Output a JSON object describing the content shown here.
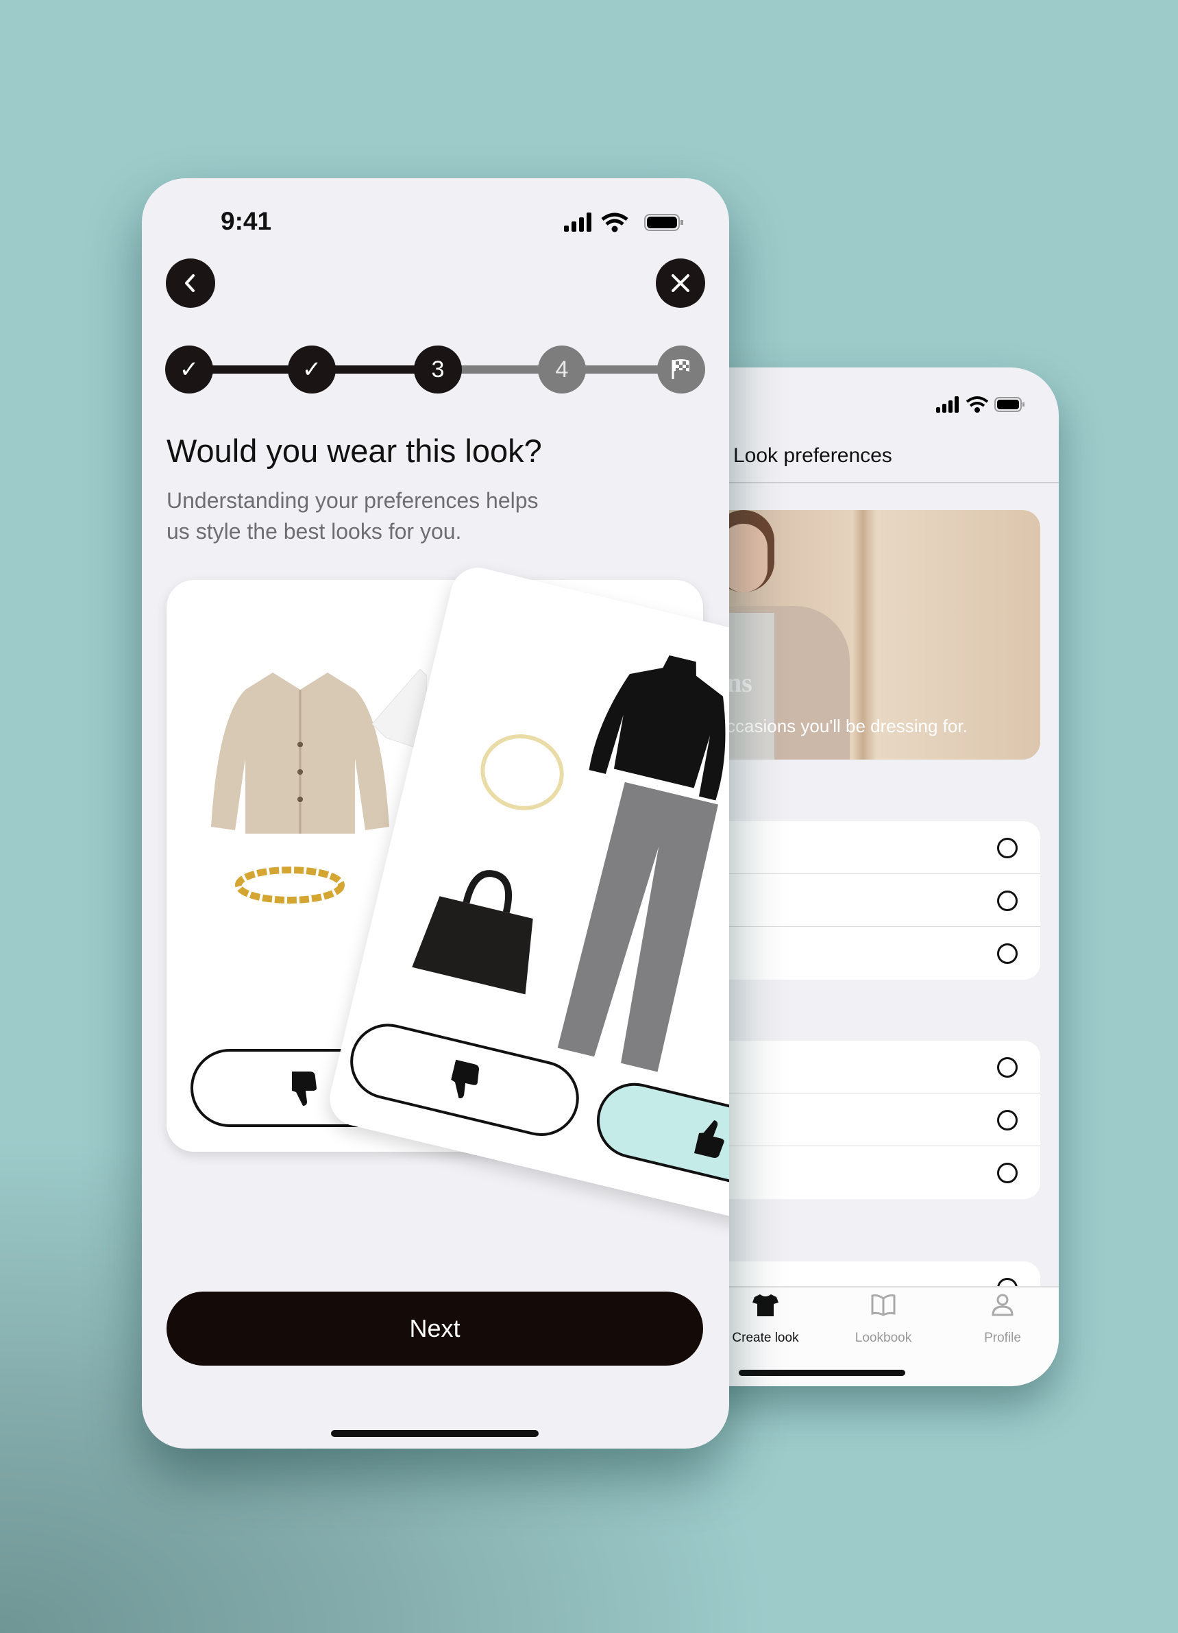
{
  "front_screen": {
    "status_time": "9:41",
    "back_icon": "chevron-left-icon",
    "close_icon": "close-icon",
    "steps": [
      {
        "label": "✓",
        "state": "done"
      },
      {
        "label": "✓",
        "state": "done"
      },
      {
        "label": "3",
        "state": "current"
      },
      {
        "label": "4",
        "state": "upcoming"
      },
      {
        "label": "finish-flag-icon",
        "state": "upcoming"
      }
    ],
    "title": "Would you wear this look?",
    "subtitle_line1": "Understanding your preferences helps",
    "subtitle_line2": "us style the best looks for you.",
    "next_label": "Next",
    "colors": {
      "primary": "#140a08",
      "like": "#c5ebe9",
      "progress_done": "#1a1414",
      "progress_upcoming": "#7d7d7d"
    }
  },
  "back_screen": {
    "title": "Look preferences",
    "hero_title_fragment": "ns",
    "hero_text_fragment": "ccasions you'll be dressing for.",
    "tabs": [
      {
        "label": "Create look",
        "icon": "tshirt-icon",
        "active": true
      },
      {
        "label": "Lookbook",
        "icon": "book-icon",
        "active": false
      },
      {
        "label": "Profile",
        "icon": "person-icon",
        "active": false
      }
    ]
  }
}
